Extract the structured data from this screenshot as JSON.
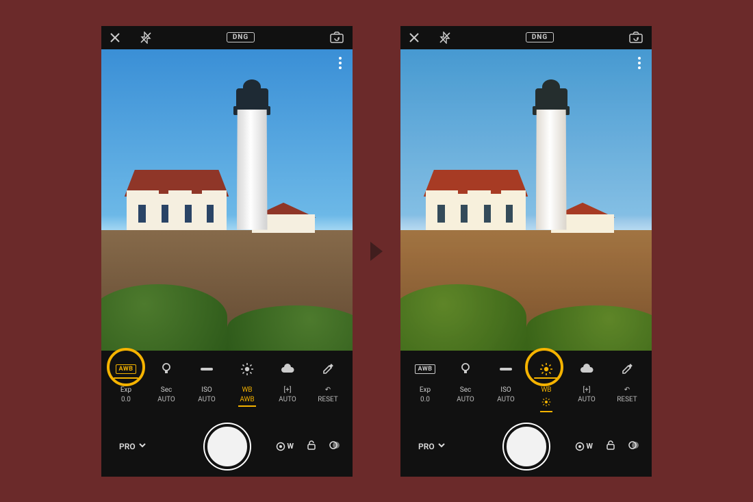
{
  "top": {
    "format_badge": "DNG"
  },
  "wb_presets": {
    "awb_label": "AWB"
  },
  "params": {
    "exp": {
      "label": "Exp",
      "value": "0.0"
    },
    "sec": {
      "label": "Sec",
      "value": "AUTO"
    },
    "iso": {
      "label": "ISO",
      "value": "AUTO"
    },
    "wb": {
      "label": "WB",
      "value": "AWB"
    },
    "focus": {
      "label": "[+]",
      "value": "AUTO"
    },
    "reset": {
      "label": "↶",
      "value": "RESET"
    }
  },
  "params_right": {
    "wb": {
      "label": "WB"
    }
  },
  "bottom": {
    "mode_label": "PRO",
    "raw_badge": "W"
  }
}
